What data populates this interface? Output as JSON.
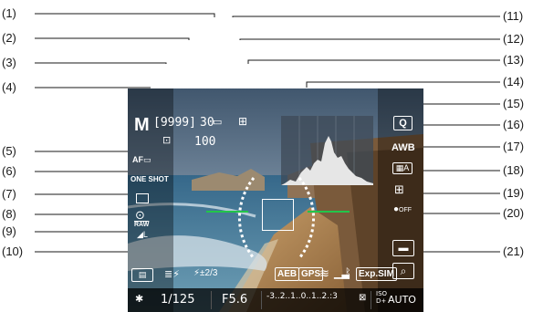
{
  "callouts_left": [
    {
      "label": "(1)"
    },
    {
      "label": "(2)"
    },
    {
      "label": "(3)"
    },
    {
      "label": "(4)"
    },
    {
      "label": "(5)"
    },
    {
      "label": "(6)"
    },
    {
      "label": "(7)"
    },
    {
      "label": "(8)"
    },
    {
      "label": "(9)"
    },
    {
      "label": "(10)"
    }
  ],
  "callouts_right": [
    {
      "label": "(11)"
    },
    {
      "label": "(12)"
    },
    {
      "label": "(13)"
    },
    {
      "label": "(14)"
    },
    {
      "label": "(15)"
    },
    {
      "label": "(16)"
    },
    {
      "label": "(17)"
    },
    {
      "label": "(18)"
    },
    {
      "label": "(19)"
    },
    {
      "label": "(20)"
    },
    {
      "label": "(21)"
    }
  ],
  "hud": {
    "shooting_mode": "M",
    "shots_remaining": "[9999]",
    "burst": "30",
    "iso_value": "100",
    "af_method": "AF",
    "af_operation": "ONE SHOT",
    "raw_label": "RAW",
    "quick_label": "Q",
    "wb_label": "AWB",
    "picture_style": "A",
    "gps_off": "OFF"
  },
  "indicator_row": {
    "aeb": "AEB",
    "gps": "GPS",
    "exp_sim": "Exp.SIM",
    "fec": "±2/3"
  },
  "bottom_bar": {
    "shutter": "1/125",
    "aperture": "F5.6",
    "exposure_scale": "-3..2..1..0..1..2.:3",
    "iso_label": "ISO",
    "iso_auto": "AUTO"
  },
  "colors": {
    "level_line": "#22c54a",
    "hud_text": "#ffffff",
    "callout_line": "#1a1a1a"
  }
}
